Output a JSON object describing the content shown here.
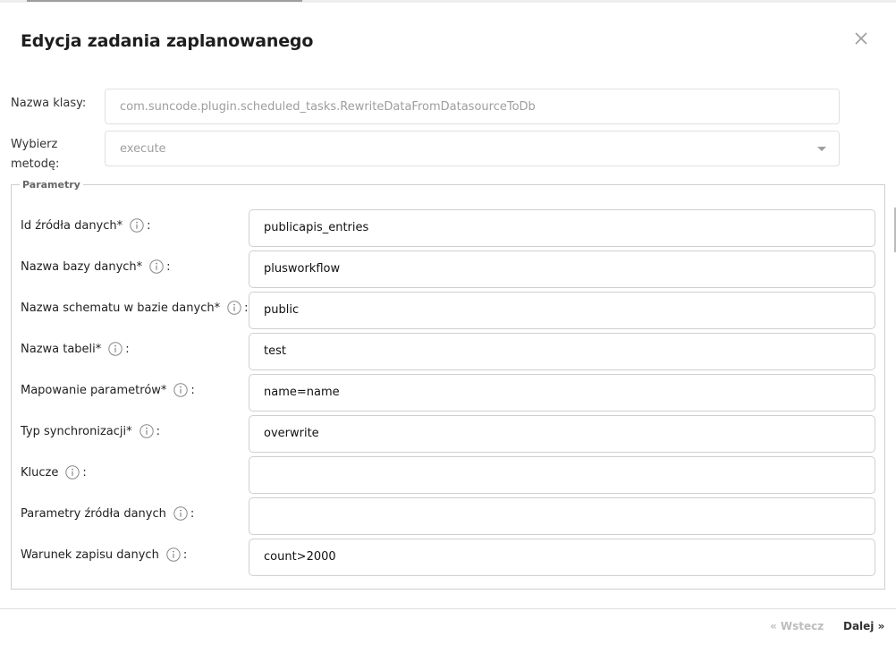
{
  "dialog": {
    "title": "Edycja zadania zaplanowanego",
    "class_label": "Nazwa klasy:",
    "class_value": "com.suncode.plugin.scheduled_tasks.RewriteDataFromDatasourceToDb",
    "method_label_line1": "Wybierz",
    "method_label_line2": "metodę:",
    "method_value": "execute",
    "params_legend": "Parametry",
    "params": [
      {
        "label": "Id źródła danych*",
        "colon": ":",
        "value": "publicapis_entries"
      },
      {
        "label": "Nazwa bazy danych*",
        "colon": ":",
        "value": "plusworkflow"
      },
      {
        "label": "Nazwa schematu w bazie danych*",
        "colon": ":",
        "value": "public"
      },
      {
        "label": "Nazwa tabeli*",
        "colon": ":",
        "value": "test"
      },
      {
        "label": "Mapowanie parametrów*",
        "colon": ":",
        "value": "name=name"
      },
      {
        "label": "Typ synchronizacji*",
        "colon": ":",
        "value": "overwrite"
      },
      {
        "label": "Klucze",
        "colon": ":",
        "value": ""
      },
      {
        "label": "Parametry źródła danych",
        "colon": ":",
        "value": ""
      },
      {
        "label": "Warunek zapisu danych",
        "colon": ":",
        "value": "count>2000"
      }
    ],
    "footer": {
      "back_label": "« Wstecz",
      "next_label": "Dalej »"
    }
  },
  "icons": {
    "close": "close-icon",
    "info": "info-icon",
    "dropdown": "chevron-down-icon"
  }
}
